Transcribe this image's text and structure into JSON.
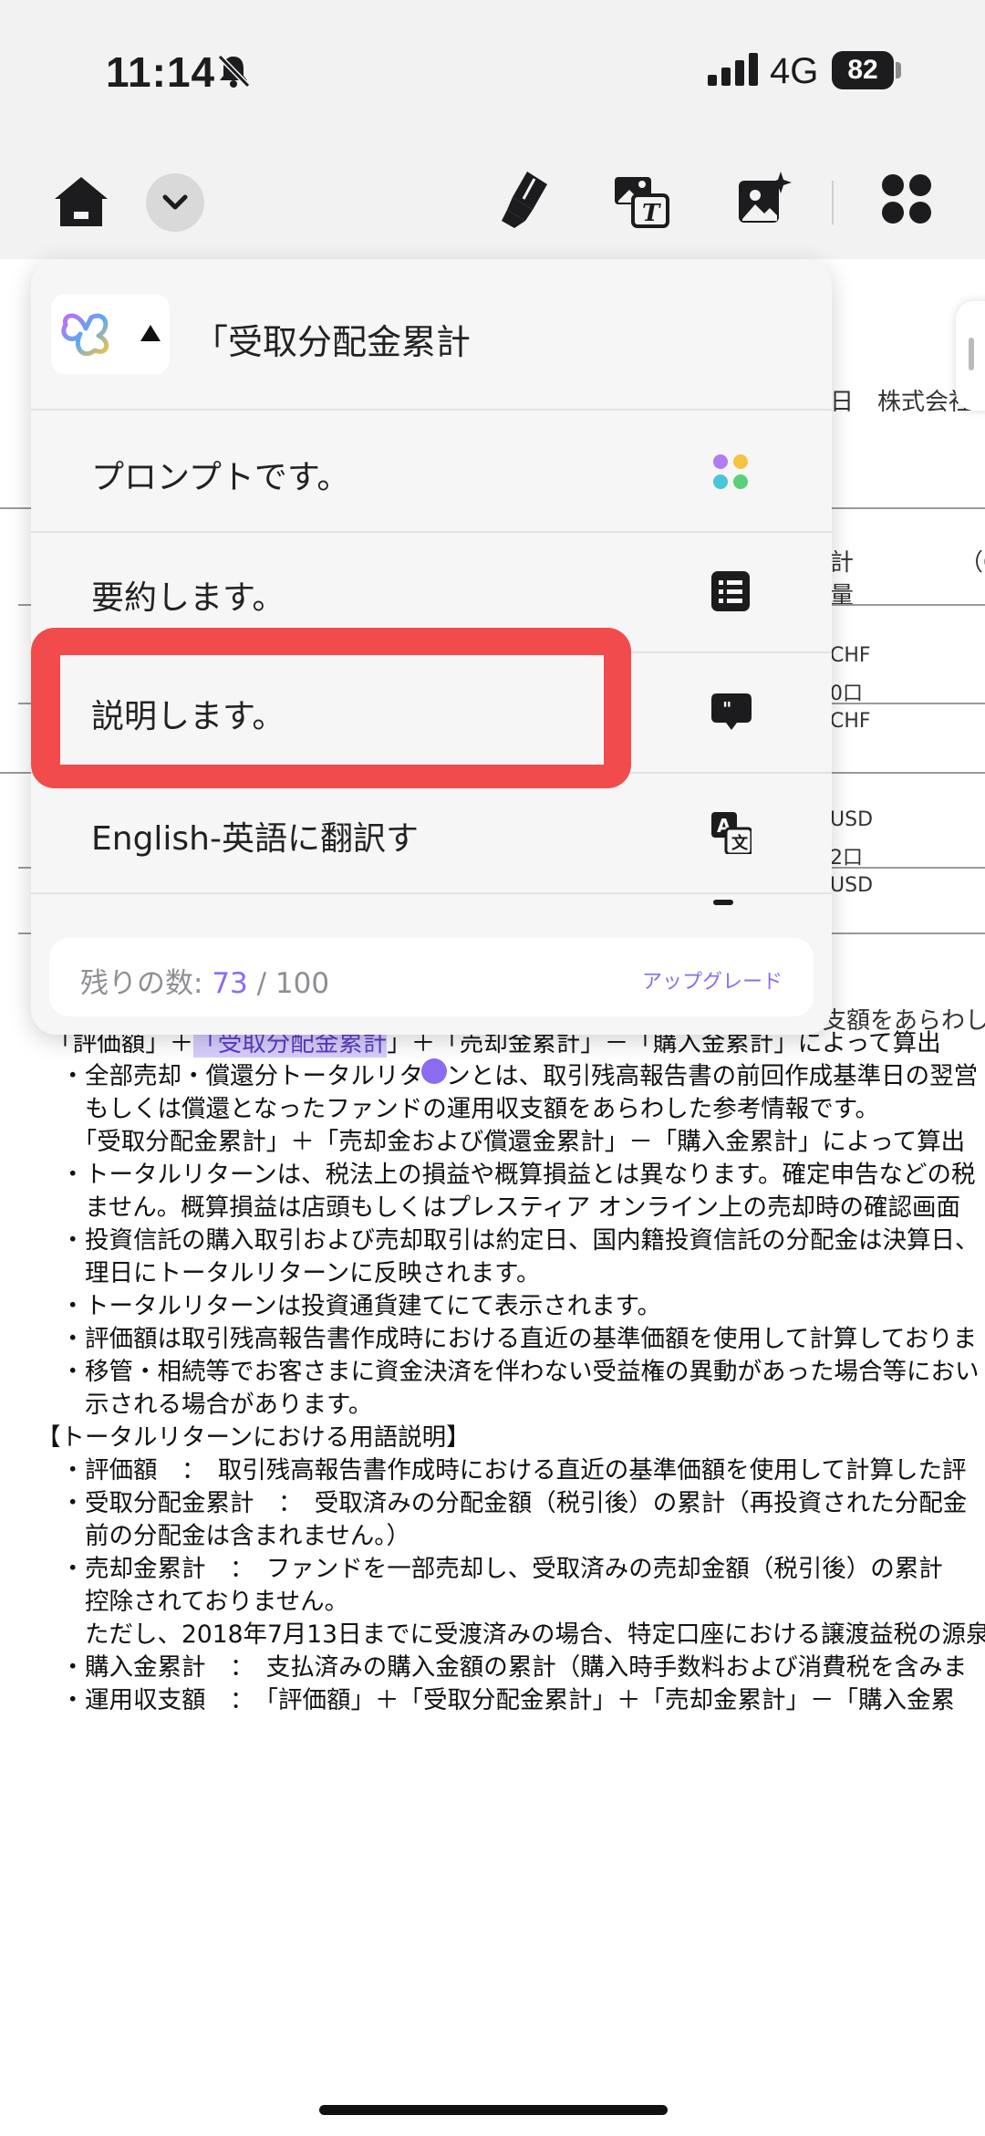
{
  "status_bar": {
    "time": "11:14",
    "network": "4G",
    "battery": "82"
  },
  "toolbar": {
    "icons": [
      "home-icon",
      "chevron-down-icon",
      "highlighter-icon",
      "translate-image-icon",
      "ai-image-icon",
      "apps-grid-icon"
    ]
  },
  "popup": {
    "title": "「受取分配金累計",
    "menu": [
      {
        "label": "プロンプトです。",
        "icon": "colored-dots-icon"
      },
      {
        "label": "要約します。",
        "icon": "list-icon"
      },
      {
        "label": "説明します。",
        "icon": "explain-bubble-icon"
      },
      {
        "label": "English-英語に翻訳す",
        "icon": "translate-icon"
      }
    ],
    "quota": {
      "label": "残りの数: ",
      "used": "73",
      "sep": " / ",
      "total": "100",
      "upgrade": "アップグレード"
    }
  },
  "document": {
    "right_fragments": [
      "日　株式会社",
      "計",
      "量",
      "（C",
      "CHF",
      "0口",
      "CHF",
      "USD",
      "2口",
      "USD",
      "支額をあらわし"
    ],
    "lines": [
      "　「評価額」＋",
      "　・全部売却・償還分トータルリターンとは、取引残高報告書の前回作成基準日の翌営",
      "　　もしくは償還となったファンドの運用収支額をあらわした参考情報です。",
      "　　「受取分配金累計」＋「売却金および償還金累計」－「購入金累計」によって算出",
      "　・トータルリターンは、税法上の損益や概算損益とは異なります。確定申告などの税",
      "　　ません。概算損益は店頭もしくはプレスティア オンライン上の売却時の確認画面",
      "　・投資信託の購入取引および売却取引は約定日、国内籍投資信託の分配金は決算日、",
      "　　理日にトータルリターンに反映されます。",
      "　・トータルリターンは投資通貨建てにて表示されます。",
      "　・評価額は取引残高報告書作成時における直近の基準価額を使用して計算しておりま",
      "　・移管・相続等でお客さまに資金決済を伴わない受益権の異動があった場合等におい",
      "　　示される場合があります。",
      "【トータルリターンにおける用語説明】",
      "　・評価額　：　取引残高報告書作成時における直近の基準価額を使用して計算した評",
      "　・受取分配金累計　：　受取済みの分配金額（税引後）の累計（再投資された分配金",
      "　　前の分配金は含まれません。）",
      "　・売却金累計　：　ファンドを一部売却し、受取済みの売却金額（税引後）の累計",
      "　　控除されておりません。",
      "　　ただし、2018年7月13日までに受渡済みの場合、特定口座における譲渡益税の源泉",
      "　・購入金累計　：　支払済みの購入金額の累計（購入時手数料および消費税を含みま",
      "　・運用収支額　：　「評価額」＋「受取分配金累計」＋「売却金累計」－「購入金累"
    ],
    "highlight": "「受取分配金累計",
    "line1_tail": "」＋「売却金累計」－「購入金累計」によって算出"
  }
}
